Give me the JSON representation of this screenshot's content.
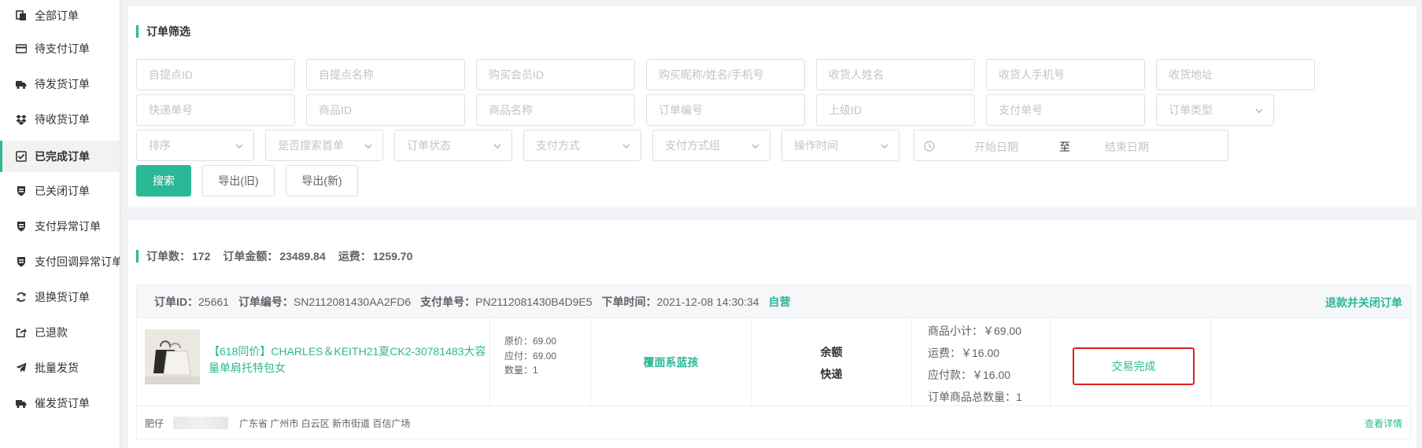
{
  "sidebar": {
    "items": [
      {
        "label": "全部订单",
        "icon": "copy-icon"
      },
      {
        "label": "待支付订单",
        "icon": "credit-card-icon"
      },
      {
        "label": "待发货订单",
        "icon": "truck-icon"
      },
      {
        "label": "待收货订单",
        "icon": "dropbox-icon"
      },
      {
        "label": "已完成订单",
        "icon": "check-square-icon"
      },
      {
        "label": "已关闭订单",
        "icon": "shield-icon"
      },
      {
        "label": "支付异常订单",
        "icon": "shield-icon"
      },
      {
        "label": "支付回调异常订单",
        "icon": "shield-icon"
      },
      {
        "label": "退换货订单",
        "icon": "refresh-icon"
      },
      {
        "label": "已退款",
        "icon": "share-square-icon"
      },
      {
        "label": "批量发货",
        "icon": "send-icon"
      },
      {
        "label": "催发货订单",
        "icon": "truck-icon"
      }
    ],
    "active_index": 4
  },
  "filter": {
    "title": "订单筛选",
    "row1": [
      "自提点ID",
      "自提点名称",
      "购买会员ID",
      "购买昵称/姓名/手机号",
      "收货人姓名",
      "收货人手机号",
      "收货地址"
    ],
    "row2": [
      "快递单号",
      "商品ID",
      "商品名称",
      "订单编号",
      "上级ID",
      "支付单号"
    ],
    "row2_select": "订单类型",
    "row3_selects": [
      "排序",
      "是否搜索首单",
      "订单状态",
      "支付方式",
      "支付方式组",
      "操作时间"
    ],
    "date_start": "开始日期",
    "date_sep": "至",
    "date_end": "结束日期",
    "search_label": "搜索",
    "export_old_label": "导出(旧)",
    "export_new_label": "导出(新)"
  },
  "stats": {
    "count_label": "订单数：",
    "count": "172",
    "amount_label": "订单金额：",
    "amount": "23489.84",
    "freight_label": "运费：",
    "freight": "1259.70"
  },
  "order": {
    "id_label": "订单ID：",
    "id": "25661",
    "no_label": "订单编号：",
    "no": "SN2112081430AA2FD6",
    "pay_no_label": "支付单号：",
    "pay_no": "PN2112081430B4D9E5",
    "time_label": "下单时间：",
    "time": "2021-12-08 14:30:34",
    "tag": "自营",
    "action": "退款并关闭订单",
    "product_name": "【618同价】CHARLES＆KEITH21夏CK2-30781483大容量单肩托特包女",
    "original_price": "原价：69.00",
    "payable_price": "应付：69.00",
    "quantity": "数量：1",
    "buyer_name": "覆面系蓝孩",
    "payment_method": "余额",
    "shipping_method": "快递",
    "subtotal": "商品小计：￥69.00",
    "shipping_fee": "运费：￥16.00",
    "payable": "应付款：￥16.00",
    "total_qty": "订单商品总数量：1",
    "status": "交易完成",
    "receiver": "肥仔",
    "address": "广东省 广州市 白云区 新市街道 百信广场",
    "detail_link": "查看详情"
  },
  "colors": {
    "accent": "#2bb896",
    "highlight_border": "#e02020"
  }
}
